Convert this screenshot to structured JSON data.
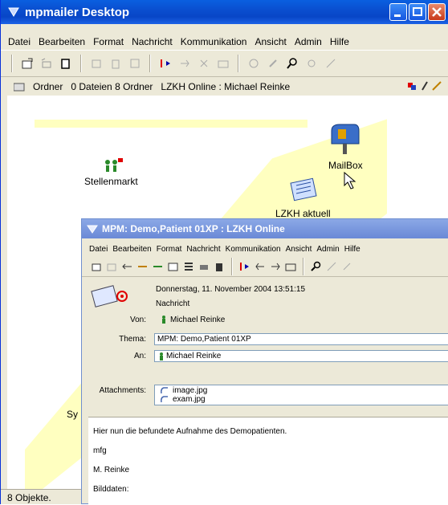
{
  "window": {
    "title": "mpmailer Desktop"
  },
  "menu": [
    "Datei",
    "Bearbeiten",
    "Format",
    "Nachricht",
    "Kommunikation",
    "Ansicht",
    "Admin",
    "Hilfe"
  ],
  "pathbar": {
    "folder_label": "Ordner",
    "counts": "0 Dateien 8 Ordner",
    "location": "LZKH Online : Michael Reinke"
  },
  "desktop_icons": {
    "stellenmarkt": "Stellenmarkt",
    "mailbox": "MailBox",
    "lzkh": "LZKH  aktuell",
    "partial": "Sy"
  },
  "status": {
    "text": "8 Objekte."
  },
  "message_window": {
    "title": "MPM: Demo,Patient 01XP  : LZKH Online",
    "menu": [
      "Datei",
      "Bearbeiten",
      "Format",
      "Nachricht",
      "Kommunikation",
      "Ansicht",
      "Admin",
      "Hilfe"
    ],
    "date": "Donnerstag, 11. November 2004 13:51:15",
    "type": "Nachricht",
    "von_label": "Von:",
    "von_value": "Michael Reinke",
    "thema_label": "Thema:",
    "thema_value": "MPM: Demo,Patient 01XP",
    "an_label": "An:",
    "an_value": "Michael Reinke",
    "attachments_label": "Attachments:",
    "attachments": [
      "image.jpg",
      "exam.jpg"
    ],
    "body_lines": [
      "Hier nun die befundete Aufnahme des Demopatienten.",
      "mfg",
      "M. Reinke",
      "Bilddaten:"
    ]
  },
  "colors": {
    "titlebar": "#0a4fd0",
    "accent_yellow": "#ffffc0",
    "flag_red": "#e00000"
  }
}
